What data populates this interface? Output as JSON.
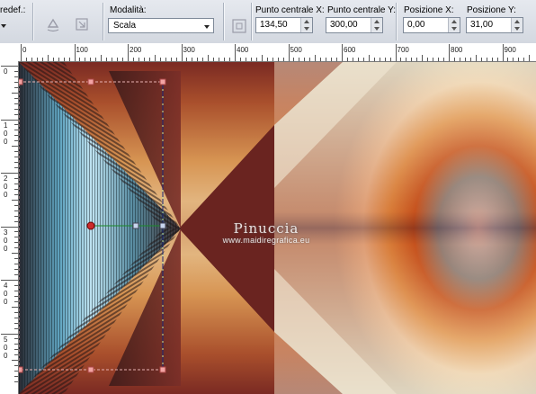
{
  "toolbar": {
    "preset_label": "redef.:",
    "mode_label": "Modalità:",
    "mode_value": "Scala",
    "center_x_label": "Punto centrale X:",
    "center_x_value": "134,50",
    "center_y_label": "Punto centrale Y:",
    "center_y_value": "300,00",
    "pos_x_label": "Posizione X:",
    "pos_x_value": "0,00",
    "pos_y_label": "Posizione Y:",
    "pos_y_value": "31,00",
    "icons": [
      "preset-dropdown-icon",
      "rotate-tool-icon",
      "scale-tool-icon",
      "center-point-icon"
    ]
  },
  "ruler": {
    "horizontal": [
      "0",
      "100",
      "200",
      "300",
      "400",
      "500",
      "600",
      "700",
      "800",
      "900"
    ],
    "vertical": [
      "0",
      "1\n0\n0",
      "2\n0\n0",
      "3\n0\n0",
      "4\n0\n0",
      "5\n0\n0"
    ]
  },
  "watermark": {
    "line1": "Pinuccia",
    "line2": "www.maidiregrafica.eu"
  },
  "colors": {
    "deep_red": "#6b2323",
    "orange": "#d9883d",
    "cream": "#f4ead2",
    "light_blue": "#a9d6ea",
    "handle_pink": "#f2a3a3",
    "handle_red": "#cc2b2b"
  }
}
